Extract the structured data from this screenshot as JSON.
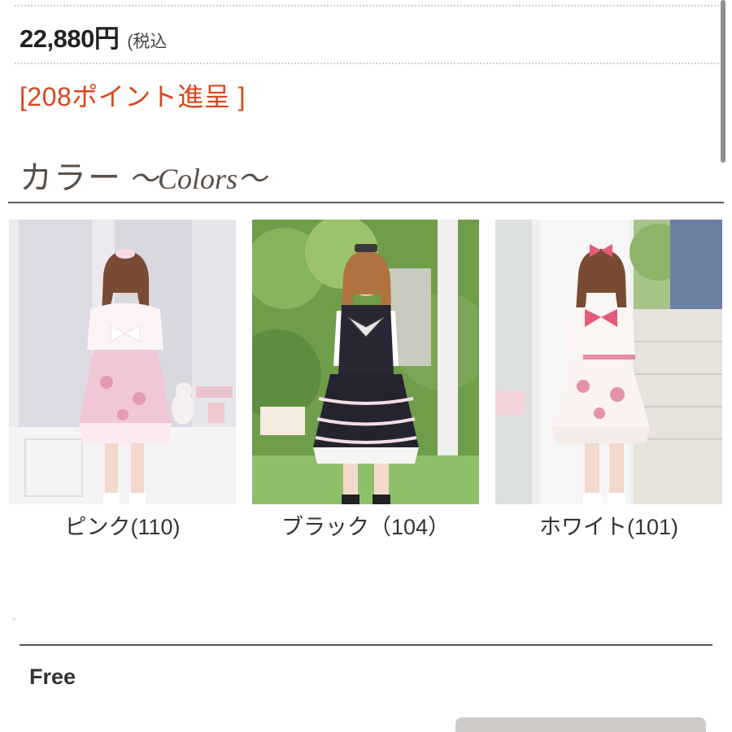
{
  "product": {
    "price": "22,880円",
    "tax_note": "(税込",
    "points": "[208ポイント進呈 ]"
  },
  "colors_section": {
    "heading_jp": "カラー",
    "heading_en": "～Colors～",
    "swatches": [
      {
        "label": "ピンク(110)",
        "image": "pink-dress-photo"
      },
      {
        "label": "ブラック（104）",
        "image": "black-dress-photo"
      },
      {
        "label": "ホワイト(101)",
        "image": "white-dress-photo"
      }
    ]
  },
  "size_section": {
    "size_label": "Free"
  },
  "theme": {
    "price_color": "#222222",
    "points_color": "#d9471b",
    "heading_color": "#5a4f48",
    "button_color": "#cfcbc8"
  }
}
